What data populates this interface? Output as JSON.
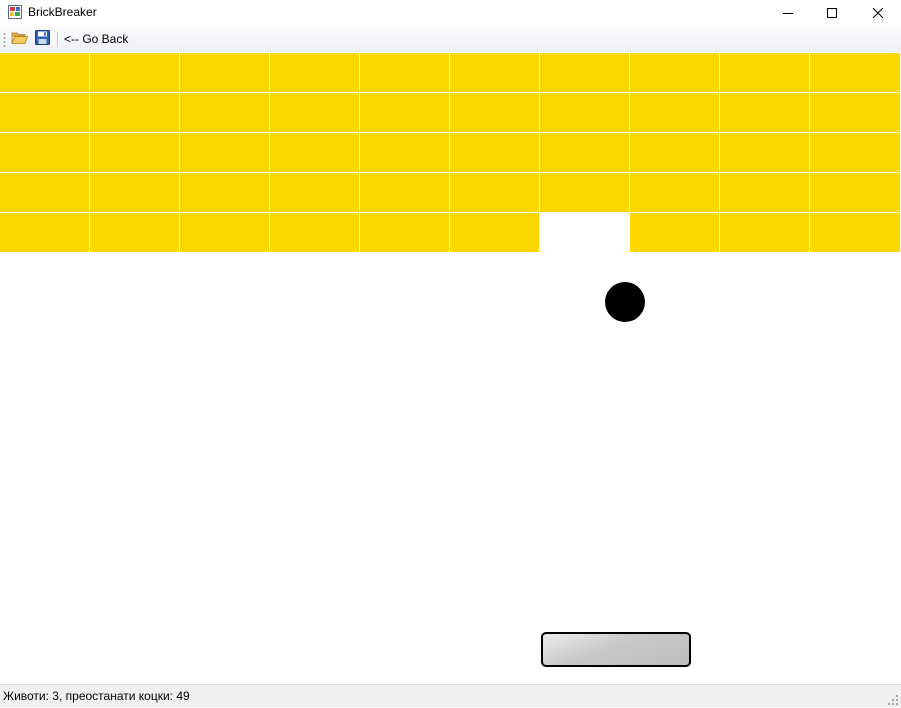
{
  "window": {
    "title": "BrickBreaker",
    "controls": [
      "minimize-icon",
      "maximize-icon",
      "close-icon"
    ]
  },
  "toolbar": {
    "open_icon": "folder-open-icon",
    "save_icon": "save-icon",
    "back_label": "<-- Go Back"
  },
  "game": {
    "brick_color": "#ffd700",
    "columns": 10,
    "rows": 5,
    "bricks": [
      [
        1,
        1,
        1,
        1,
        1,
        1,
        1,
        1,
        1,
        1
      ],
      [
        1,
        1,
        1,
        1,
        1,
        1,
        1,
        1,
        1,
        1
      ],
      [
        1,
        1,
        1,
        1,
        1,
        1,
        1,
        1,
        1,
        1
      ],
      [
        1,
        1,
        1,
        1,
        1,
        1,
        1,
        1,
        1,
        1
      ],
      [
        1,
        1,
        1,
        1,
        1,
        1,
        0,
        1,
        1,
        1
      ]
    ],
    "ball_color": "#000000",
    "paddle_color": "#c0c0c0"
  },
  "status": {
    "text": "Животи: 3, преостанати коцки: 49"
  }
}
